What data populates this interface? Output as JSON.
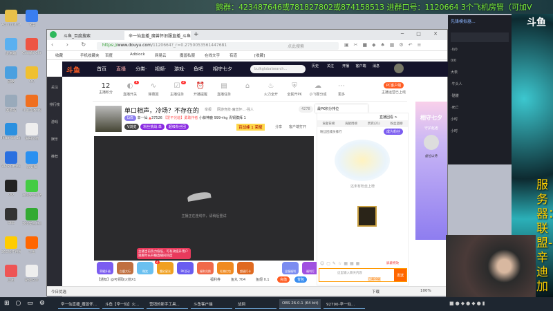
{
  "overlay": {
    "banner": "鹅群：423487646或781827802或874158513   进群口号：1120664   3个飞机房管（可加V",
    "server_text": "服务器：联盟-辛迪加",
    "logo": "斗鱼"
  },
  "desktop_icons": [
    "Administrator",
    "飞书",
    "此电脑",
    "Google Chrome",
    "网络",
    "QQ",
    "回收站",
    "斗鱼直播伴侣",
    "Internet Explorer",
    "说明文档",
    "WPS Office",
    "云剪辑",
    "QQ",
    "360安全浏览器",
    "OBS",
    "360安全卫士",
    "360软件管家",
    "斗鱼",
    "应用",
    "新建文本"
  ],
  "browser": {
    "tabs": [
      {
        "label": "斗鱼_百度搜索"
      },
      {
        "label": "辛一仙直播_魔兽怀旧服直播_斗鱼"
      }
    ],
    "new_tab": "+",
    "url_scheme": "https://",
    "url_host": "www.douyu.com",
    "url_path": "/1120664?_r=0.2750053561447681",
    "search_placeholder": "点此搜索",
    "bookmarks": [
      "收藏",
      "手机收藏夹",
      "百度",
      "Adblock",
      "网易云",
      "魔兽私服",
      "在线文字",
      "有道",
      "[收藏]"
    ]
  },
  "douyu": {
    "nav": [
      "首页",
      "直播",
      "分类·",
      "视频·",
      "游戏·",
      "鱼吧",
      "相守七夕"
    ],
    "search_placeholder": "bulkglobalsearch...",
    "header_icons": [
      "历史",
      "关注",
      "开播",
      "客户端",
      "消息"
    ],
    "sidebar": [
      "关注",
      "排行榜",
      "游戏",
      "娱乐",
      "推荐"
    ],
    "toolbar": {
      "score": "12",
      "score_label": "主播积分",
      "items": [
        "直播开关",
        "弹幕回",
        "主播任务",
        "开播提醒",
        "直播任务",
        "",
        "火力全开",
        "全民开PK",
        "小飞碟分成",
        "更多"
      ],
      "badges": [
        "1",
        "2"
      ],
      "pc_client": "PC客户端",
      "pc_sub": "主播运营已上线"
    },
    "stream": {
      "title": "单口相声，冷场？不存在的",
      "category": "举报",
      "breadcrumb": "网游竞技·魔兽怀...·强人",
      "level": "LV5",
      "name": "辛一仙",
      "hot": "37526",
      "fans": "【爱不光临】勇敢作者",
      "stat1": "小蒜神鹿",
      "stat2": "999+kg",
      "stat3": "青铜膜拜 1",
      "tags": [
        "V浏览",
        "粉丝挑战 单",
        "超级粉丝团"
      ],
      "promo": "百战峰 1 荣耀",
      "share": "分享",
      "client": "客户端打开",
      "room": "4278"
    },
    "video_status": "主播正在连线中，请稍后重试",
    "tooltip": "主播当前热力值低，可有效提升用户观看时长开播直播间热度",
    "gifts": [
      "荣耀升级",
      "白鹿大行",
      "微笑",
      "魔幻星光",
      "PK活动",
      "福利兑换",
      "礼物红包",
      "超级打卡",
      "全服福利",
      "福利打"
    ],
    "gift_badge": "4",
    "input_bar": {
      "tip": "【通知】@可领取火箭X1",
      "welfare": "福利券",
      "fish": "鱼丸 704",
      "pts": "鱼翅 0.1",
      "btn1": "充值",
      "btn2": "背包"
    },
    "chat": {
      "pk_notice": "最PK积分排位",
      "replay": "直播回看 >",
      "tabs": [
        "贡献日榜",
        "贡献周榜",
        "贵宾(21)",
        "粉丝团榜"
      ],
      "fans_title": "粉丝团成员排行",
      "join_btn": "成为粉丝",
      "empty": "还未有粉丝上榜",
      "mute": "屏蔽特效",
      "input_placeholder": "这里输入聊天内容",
      "level_tag": "已满30级",
      "send": "发送"
    },
    "promo": {
      "title": "相守七夕",
      "guard": "守护赵者",
      "user": "虚位以待"
    }
  },
  "status_bar": {
    "left": "今日优选",
    "items": [
      "下载",
      "100%"
    ]
  },
  "dark_window": {
    "title": "先锋模拟器...",
    "entries": [
      "·0/0",
      "0/0",
      "大表",
      "·牛头人",
      "·骷髅",
      "·死亡",
      "小时",
      "小时"
    ]
  },
  "taskbar": [
    {
      "label": "辛一仙直播_魔兽怀..."
    },
    {
      "label": "斗鱼【辛一仙】火..."
    },
    {
      "label": "营销的新手工具..."
    },
    {
      "label": "斗鱼客户端"
    },
    {
      "label": "战网"
    },
    {
      "label": "OBS 26.0.1 (64 bit)"
    },
    {
      "label": "92790-辛一仙..."
    }
  ],
  "colors": {
    "douyu_header": "#15142b",
    "accent": "#ff5d23",
    "banner_green": "#7cf23a"
  }
}
